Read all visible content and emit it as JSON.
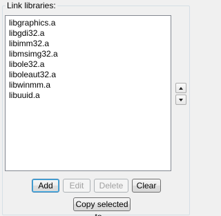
{
  "group": {
    "title": "Link libraries:"
  },
  "libraries": [
    "libgraphics.a",
    "libgdi32.a",
    "libimm32.a",
    "libmsimg32.a",
    "libole32.a",
    "liboleaut32.a",
    "libwinmm.a",
    "libuuid.a"
  ],
  "buttons": {
    "add": "Add",
    "edit": "Edit",
    "delete": "Delete",
    "clear": "Clear",
    "copy_selected": "Copy selected to..."
  },
  "button_states": {
    "edit_enabled": false,
    "delete_enabled": false
  },
  "icons": {
    "move_up": "triangle-up-icon",
    "move_down": "triangle-down-icon"
  }
}
